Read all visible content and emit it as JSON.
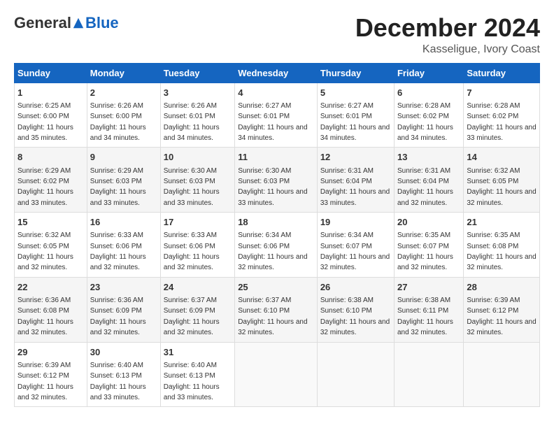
{
  "header": {
    "logo_general": "General",
    "logo_blue": "Blue",
    "month_title": "December 2024",
    "location": "Kasseligue, Ivory Coast"
  },
  "columns": [
    "Sunday",
    "Monday",
    "Tuesday",
    "Wednesday",
    "Thursday",
    "Friday",
    "Saturday"
  ],
  "weeks": [
    [
      {
        "day": "1",
        "sunrise": "6:25 AM",
        "sunset": "6:00 PM",
        "daylight": "11 hours and 35 minutes."
      },
      {
        "day": "2",
        "sunrise": "6:26 AM",
        "sunset": "6:00 PM",
        "daylight": "11 hours and 34 minutes."
      },
      {
        "day": "3",
        "sunrise": "6:26 AM",
        "sunset": "6:01 PM",
        "daylight": "11 hours and 34 minutes."
      },
      {
        "day": "4",
        "sunrise": "6:27 AM",
        "sunset": "6:01 PM",
        "daylight": "11 hours and 34 minutes."
      },
      {
        "day": "5",
        "sunrise": "6:27 AM",
        "sunset": "6:01 PM",
        "daylight": "11 hours and 34 minutes."
      },
      {
        "day": "6",
        "sunrise": "6:28 AM",
        "sunset": "6:02 PM",
        "daylight": "11 hours and 34 minutes."
      },
      {
        "day": "7",
        "sunrise": "6:28 AM",
        "sunset": "6:02 PM",
        "daylight": "11 hours and 33 minutes."
      }
    ],
    [
      {
        "day": "8",
        "sunrise": "6:29 AM",
        "sunset": "6:02 PM",
        "daylight": "11 hours and 33 minutes."
      },
      {
        "day": "9",
        "sunrise": "6:29 AM",
        "sunset": "6:03 PM",
        "daylight": "11 hours and 33 minutes."
      },
      {
        "day": "10",
        "sunrise": "6:30 AM",
        "sunset": "6:03 PM",
        "daylight": "11 hours and 33 minutes."
      },
      {
        "day": "11",
        "sunrise": "6:30 AM",
        "sunset": "6:03 PM",
        "daylight": "11 hours and 33 minutes."
      },
      {
        "day": "12",
        "sunrise": "6:31 AM",
        "sunset": "6:04 PM",
        "daylight": "11 hours and 33 minutes."
      },
      {
        "day": "13",
        "sunrise": "6:31 AM",
        "sunset": "6:04 PM",
        "daylight": "11 hours and 32 minutes."
      },
      {
        "day": "14",
        "sunrise": "6:32 AM",
        "sunset": "6:05 PM",
        "daylight": "11 hours and 32 minutes."
      }
    ],
    [
      {
        "day": "15",
        "sunrise": "6:32 AM",
        "sunset": "6:05 PM",
        "daylight": "11 hours and 32 minutes."
      },
      {
        "day": "16",
        "sunrise": "6:33 AM",
        "sunset": "6:06 PM",
        "daylight": "11 hours and 32 minutes."
      },
      {
        "day": "17",
        "sunrise": "6:33 AM",
        "sunset": "6:06 PM",
        "daylight": "11 hours and 32 minutes."
      },
      {
        "day": "18",
        "sunrise": "6:34 AM",
        "sunset": "6:06 PM",
        "daylight": "11 hours and 32 minutes."
      },
      {
        "day": "19",
        "sunrise": "6:34 AM",
        "sunset": "6:07 PM",
        "daylight": "11 hours and 32 minutes."
      },
      {
        "day": "20",
        "sunrise": "6:35 AM",
        "sunset": "6:07 PM",
        "daylight": "11 hours and 32 minutes."
      },
      {
        "day": "21",
        "sunrise": "6:35 AM",
        "sunset": "6:08 PM",
        "daylight": "11 hours and 32 minutes."
      }
    ],
    [
      {
        "day": "22",
        "sunrise": "6:36 AM",
        "sunset": "6:08 PM",
        "daylight": "11 hours and 32 minutes."
      },
      {
        "day": "23",
        "sunrise": "6:36 AM",
        "sunset": "6:09 PM",
        "daylight": "11 hours and 32 minutes."
      },
      {
        "day": "24",
        "sunrise": "6:37 AM",
        "sunset": "6:09 PM",
        "daylight": "11 hours and 32 minutes."
      },
      {
        "day": "25",
        "sunrise": "6:37 AM",
        "sunset": "6:10 PM",
        "daylight": "11 hours and 32 minutes."
      },
      {
        "day": "26",
        "sunrise": "6:38 AM",
        "sunset": "6:10 PM",
        "daylight": "11 hours and 32 minutes."
      },
      {
        "day": "27",
        "sunrise": "6:38 AM",
        "sunset": "6:11 PM",
        "daylight": "11 hours and 32 minutes."
      },
      {
        "day": "28",
        "sunrise": "6:39 AM",
        "sunset": "6:12 PM",
        "daylight": "11 hours and 32 minutes."
      }
    ],
    [
      {
        "day": "29",
        "sunrise": "6:39 AM",
        "sunset": "6:12 PM",
        "daylight": "11 hours and 32 minutes."
      },
      {
        "day": "30",
        "sunrise": "6:40 AM",
        "sunset": "6:13 PM",
        "daylight": "11 hours and 33 minutes."
      },
      {
        "day": "31",
        "sunrise": "6:40 AM",
        "sunset": "6:13 PM",
        "daylight": "11 hours and 33 minutes."
      },
      null,
      null,
      null,
      null
    ]
  ]
}
